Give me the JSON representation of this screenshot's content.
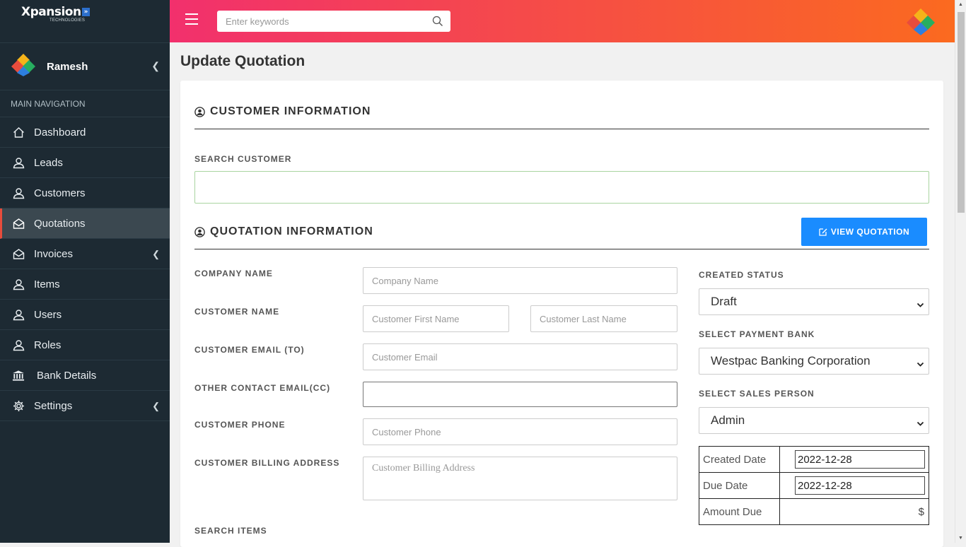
{
  "brand": {
    "name": "Xpansion",
    "badge": "»",
    "sub": "TECHNOLOGIES"
  },
  "user": {
    "name": "Ramesh"
  },
  "nav": {
    "header": "MAIN NAVIGATION",
    "items": [
      {
        "label": "Dashboard",
        "icon": "home-icon"
      },
      {
        "label": "Leads",
        "icon": "user-icon"
      },
      {
        "label": "Customers",
        "icon": "user-icon"
      },
      {
        "label": "Quotations",
        "icon": "envelope-icon",
        "active": true
      },
      {
        "label": "Invoices",
        "icon": "envelope-icon",
        "has_submenu": true
      },
      {
        "label": "Items",
        "icon": "user-icon"
      },
      {
        "label": "Users",
        "icon": "user-icon"
      },
      {
        "label": "Roles",
        "icon": "user-icon"
      },
      {
        "label": "Bank Details",
        "icon": "bank-icon"
      },
      {
        "label": "Settings",
        "icon": "gear-icon",
        "has_submenu": true
      }
    ]
  },
  "header": {
    "search_placeholder": "Enter keywords"
  },
  "page": {
    "title": "Update Quotation"
  },
  "customer_section": {
    "title": "CUSTOMER INFORMATION",
    "search_label": "SEARCH CUSTOMER",
    "search_value": ""
  },
  "quotation_section": {
    "title": "QUOTATION INFORMATION",
    "view_button": "VIEW QUOTATION",
    "company_name_label": "COMPANY NAME",
    "company_name_placeholder": "Company Name",
    "customer_name_label": "CUSTOMER NAME",
    "first_name_placeholder": "Customer First Name",
    "last_name_placeholder": "Customer Last Name",
    "email_label": "CUSTOMER EMAIL (TO)",
    "email_placeholder": "Customer Email",
    "cc_label": "OTHER CONTACT EMAIL(CC)",
    "cc_value": "",
    "phone_label": "CUSTOMER PHONE",
    "phone_placeholder": "Customer Phone",
    "address_label": "CUSTOMER BILLING ADDRESS",
    "address_placeholder": "Customer Billing Address",
    "search_items_label": "SEARCH ITEMS",
    "created_status_label": "CREATED STATUS",
    "created_status_value": "Draft",
    "payment_bank_label": "SELECT PAYMENT BANK",
    "payment_bank_value": "Westpac Banking Corporation",
    "sales_person_label": "SELECT SALES PERSON",
    "sales_person_value": "Admin",
    "created_date_label": "Created Date",
    "created_date_value": "2022-12-28",
    "due_date_label": "Due Date",
    "due_date_value": "2022-12-28",
    "amount_due_label": "Amount Due",
    "amount_due_currency": "$"
  },
  "colors": {
    "accent_gradient_start": "#f2306d",
    "accent_gradient_end": "#fb6a1f",
    "sidebar_bg": "#1d2a33",
    "button_blue": "#1a8cff",
    "active_marker": "#e74c3c"
  }
}
